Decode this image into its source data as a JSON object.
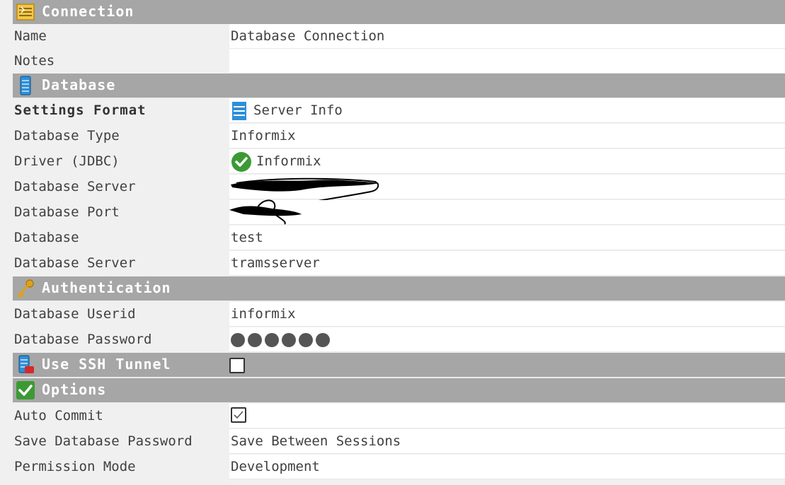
{
  "sections": {
    "connection": {
      "title": "Connection"
    },
    "database": {
      "title": "Database"
    },
    "authentication": {
      "title": "Authentication"
    },
    "ssh": {
      "title": "Use SSH Tunnel",
      "checked": false
    },
    "options": {
      "title": "Options"
    }
  },
  "connection": {
    "name_label": "Name",
    "name_value": "Database Connection",
    "notes_label": "Notes",
    "notes_value": ""
  },
  "database": {
    "settings_format_label": "Settings Format",
    "settings_format_value": "Server Info",
    "type_label": "Database Type",
    "type_value": "Informix",
    "driver_label": "Driver (JDBC)",
    "driver_value": "Informix",
    "server_label": "Database Server",
    "port_label": "Database Port",
    "db_label": "Database",
    "db_value": "test",
    "server2_label": "Database Server",
    "server2_value": "tramsserver"
  },
  "authentication": {
    "userid_label": "Database Userid",
    "userid_value": "informix",
    "password_label": "Database Password"
  },
  "options": {
    "autocommit_label": "Auto Commit",
    "autocommit_checked": true,
    "savepw_label": "Save Database Password",
    "savepw_value": "Save Between Sessions",
    "permission_label": "Permission Mode",
    "permission_value": "Development"
  },
  "colors": {
    "section_bg": "#a6a6a6",
    "check_green": "#3c9a35",
    "key_gold": "#e0a21a",
    "db_blue": "#2e8fd8"
  }
}
